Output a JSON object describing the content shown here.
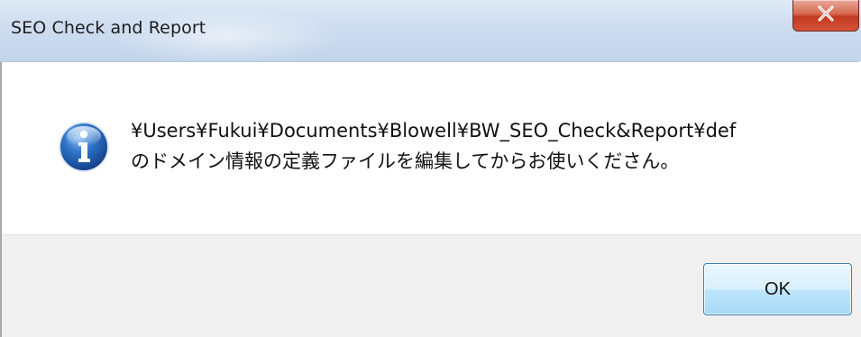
{
  "window": {
    "title": "SEO Check and Report"
  },
  "dialog": {
    "icon": "information-icon",
    "message_line1": "¥Users¥Fukui¥Documents¥Blowell¥BW_SEO_Check&Report¥def",
    "message_line2": "のドメイン情報の定義ファイルを編集してからお使いくださん。"
  },
  "buttons": {
    "ok_label": "OK"
  },
  "colors": {
    "close_button": "#c2391f",
    "ok_button_border": "#3c7fb1",
    "footer_background": "#f0f0f0"
  }
}
